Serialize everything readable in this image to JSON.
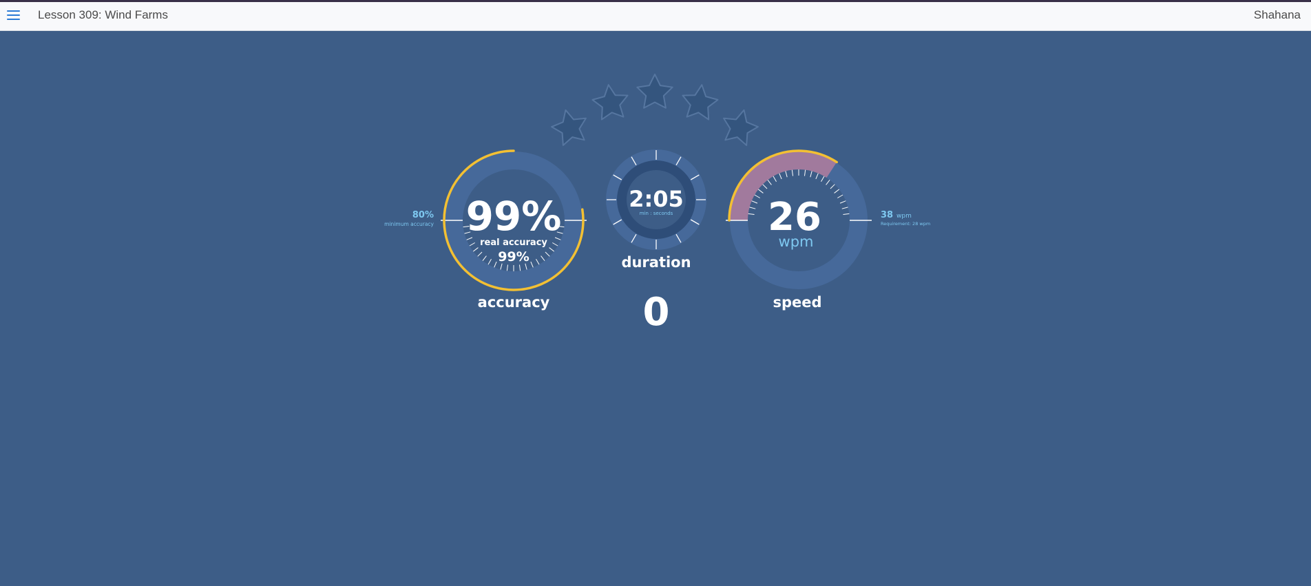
{
  "header": {
    "lesson_title": "Lesson 309: Wind Farms",
    "user_name": "Shahana"
  },
  "stars": {
    "earned": 0,
    "total": 5
  },
  "accuracy": {
    "value": "99%",
    "fraction": 0.99,
    "real_label": "real accuracy",
    "real_value": "99%",
    "min_value": "80%",
    "min_label": "minimum accuracy",
    "label": "accuracy"
  },
  "duration": {
    "value": "2:05",
    "units": "min : seconds",
    "label": "duration"
  },
  "counter": "0",
  "speed": {
    "value": "26",
    "unit": "wpm",
    "requirement_value": "38",
    "requirement_unit": "wpm",
    "requirement_label": "Requirement: 28 wpm",
    "label": "speed"
  },
  "colors": {
    "background": "#3d5d87",
    "arc_gold": "#f3c033",
    "speed_fill": "#a17a9d",
    "accent_blue": "#7ec8f0"
  }
}
